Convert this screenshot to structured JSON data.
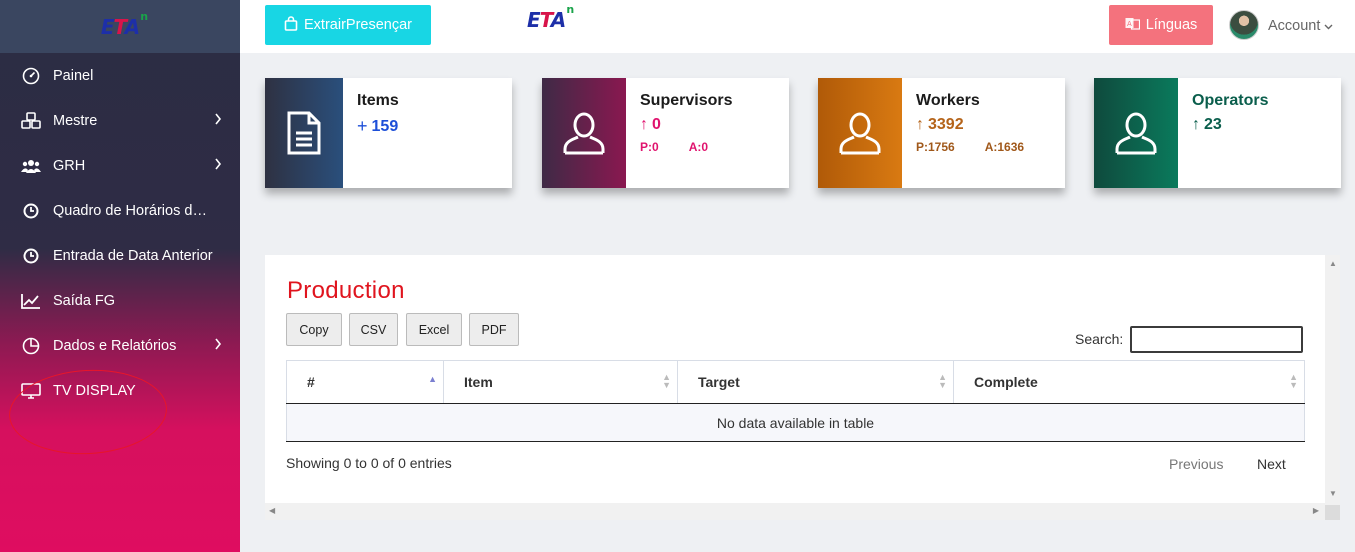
{
  "brand": {
    "logo_text": "ETA",
    "logo_superscript": "n"
  },
  "sidebar": {
    "items": [
      {
        "label": "Painel",
        "icon": "dashboard-gauge-icon",
        "has_submenu": false
      },
      {
        "label": "Mestre",
        "icon": "cubes-icon",
        "has_submenu": true
      },
      {
        "label": "GRH",
        "icon": "users-group-icon",
        "has_submenu": true
      },
      {
        "label": "Quadro de Horários de Trabalho",
        "icon": "clock-icon",
        "has_submenu": false
      },
      {
        "label": "Entrada de Data Anterior",
        "icon": "clock-icon",
        "has_submenu": false
      },
      {
        "label": "Saída FG",
        "icon": "line-chart-icon",
        "has_submenu": false
      },
      {
        "label": "Dados e Relatórios",
        "icon": "pie-chart-icon",
        "has_submenu": true
      },
      {
        "label": "TV DISPLAY",
        "icon": "monitor-icon",
        "has_submenu": false
      }
    ]
  },
  "topbar": {
    "extract_button": "ExtrairPresençar",
    "languages_button": "Línguas",
    "account_label": "Account"
  },
  "cards": {
    "items": {
      "title": "Items",
      "value": "159",
      "accent": "#1d4fd8"
    },
    "supervisors": {
      "title": "Supervisors",
      "value": "0",
      "present": "P:0",
      "absent": "A:0",
      "accent": "#e0136e"
    },
    "workers": {
      "title": "Workers",
      "value": "3392",
      "present": "P:1756",
      "absent": "A:1636",
      "accent": "#b5641a"
    },
    "operators": {
      "title": "Operators",
      "value": "23",
      "accent": "#0a5e4c"
    }
  },
  "production": {
    "title": "Production",
    "export_buttons": [
      "Copy",
      "CSV",
      "Excel",
      "PDF"
    ],
    "search_label": "Search:",
    "search_value": "",
    "columns": [
      "#",
      "Item",
      "Target",
      "Complete"
    ],
    "empty_message": "No data available in table",
    "info": "Showing 0 to 0 of 0 entries",
    "previous": "Previous",
    "next": "Next"
  }
}
